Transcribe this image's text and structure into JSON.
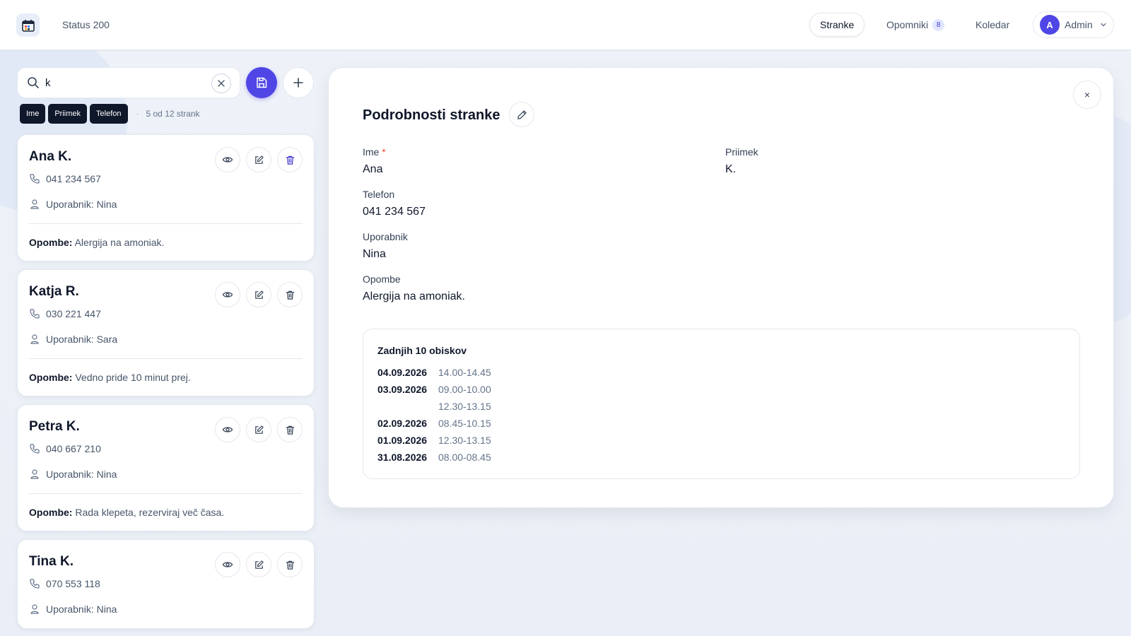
{
  "header": {
    "status": "Status 200",
    "nav": [
      {
        "label": "Stranke"
      },
      {
        "label": "Opomniki",
        "badge": "8"
      },
      {
        "label": "Koledar"
      }
    ],
    "user": {
      "initial": "A",
      "name": "Admin"
    }
  },
  "search": {
    "value": "k",
    "filters": [
      "Ime",
      "Priimek",
      "Telefon"
    ],
    "dot": "·",
    "count": "5 od 12 strank"
  },
  "clients": [
    {
      "name": "Ana K.",
      "phone": "041 234 567",
      "user": "Uporabnik: Nina",
      "notes_label": "Opombe:",
      "notes": "Alergija na amoniak."
    },
    {
      "name": "Katja R.",
      "phone": "030 221 447",
      "user": "Uporabnik: Sara",
      "notes_label": "Opombe:",
      "notes": "Vedno pride 10 minut prej."
    },
    {
      "name": "Petra K.",
      "phone": "040 667 210",
      "user": "Uporabnik: Nina",
      "notes_label": "Opombe:",
      "notes": "Rada klepeta, rezerviraj več časa."
    },
    {
      "name": "Tina K.",
      "phone": "070 553 118",
      "user": "Uporabnik: Nina"
    }
  ],
  "detail": {
    "title": "Podrobnosti stranke",
    "close": "×",
    "fields": {
      "ime_label": "Ime",
      "ime_required": "*",
      "ime": "Ana",
      "priimek_label": "Priimek",
      "priimek": "K.",
      "telefon_label": "Telefon",
      "telefon": "041 234 567",
      "uporabnik_label": "Uporabnik",
      "uporabnik": "Nina",
      "opombe_label": "Opombe",
      "opombe": "Alergija na amoniak."
    },
    "visits_title": "Zadnjih 10 obiskov",
    "visits": [
      {
        "date": "04.09.2026",
        "time": "14.00-14.45"
      },
      {
        "date": "03.09.2026",
        "time": "09.00-10.00"
      },
      {
        "date": "",
        "time": "12.30-13.15"
      },
      {
        "date": "02.09.2026",
        "time": "08.45-10.15"
      },
      {
        "date": "01.09.2026",
        "time": "12.30-13.15"
      },
      {
        "date": "31.08.2026",
        "time": "08.00-08.45"
      }
    ]
  },
  "colors": {
    "accent": "#4f46e5",
    "chip_bg": "#0f172a",
    "required": "#ef4444"
  }
}
